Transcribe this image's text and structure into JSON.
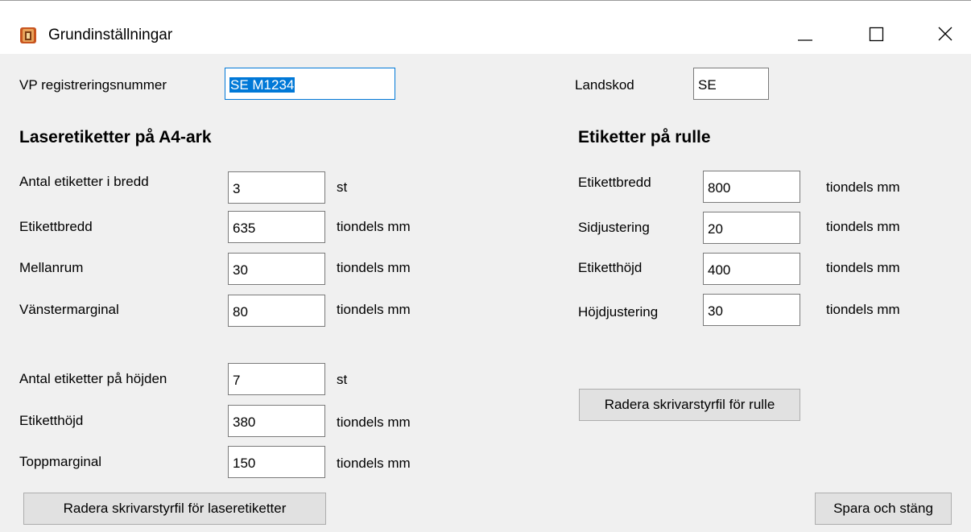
{
  "window": {
    "title": "Grundinställningar"
  },
  "vp": {
    "label": "VP registreringsnummer",
    "value": "SE M1234"
  },
  "country": {
    "label": "Landskod",
    "value": "SE"
  },
  "laser": {
    "heading": "Laseretiketter på A4-ark",
    "rows": [
      {
        "label": "Antal etiketter i bredd",
        "value": "3",
        "unit": "st"
      },
      {
        "label": "Etikettbredd",
        "value": "635",
        "unit": "tiondels mm"
      },
      {
        "label": "Mellanrum",
        "value": "30",
        "unit": "tiondels mm"
      },
      {
        "label": "Vänstermarginal",
        "value": "80",
        "unit": "tiondels mm"
      },
      {
        "label": "Antal etiketter på höjden",
        "value": "7",
        "unit": "st"
      },
      {
        "label": "Etiketthöjd",
        "value": "380",
        "unit": "tiondels mm"
      },
      {
        "label": "Toppmarginal",
        "value": "150",
        "unit": "tiondels mm"
      }
    ],
    "delete_button": "Radera skrivarstyrfil för laseretiketter"
  },
  "roll": {
    "heading": "Etiketter på rulle",
    "rows": [
      {
        "label": "Etikettbredd",
        "value": "800",
        "unit": "tiondels mm"
      },
      {
        "label": "Sidjustering",
        "value": "20",
        "unit": "tiondels mm"
      },
      {
        "label": "Etiketthöjd",
        "value": "400",
        "unit": "tiondels mm"
      },
      {
        "label": "Höjdjustering",
        "value": "30",
        "unit": "tiondels mm"
      }
    ],
    "delete_button": "Radera skrivarstyrfil för rulle"
  },
  "save_button": "Spara och stäng",
  "icons": {
    "app": "app-icon",
    "minimize": "minimize-icon",
    "maximize": "maximize-icon",
    "close": "close-icon"
  },
  "colors": {
    "focus_border": "#0078d7",
    "selection": "#0078d7",
    "window_bg": "#f0f0f0"
  }
}
